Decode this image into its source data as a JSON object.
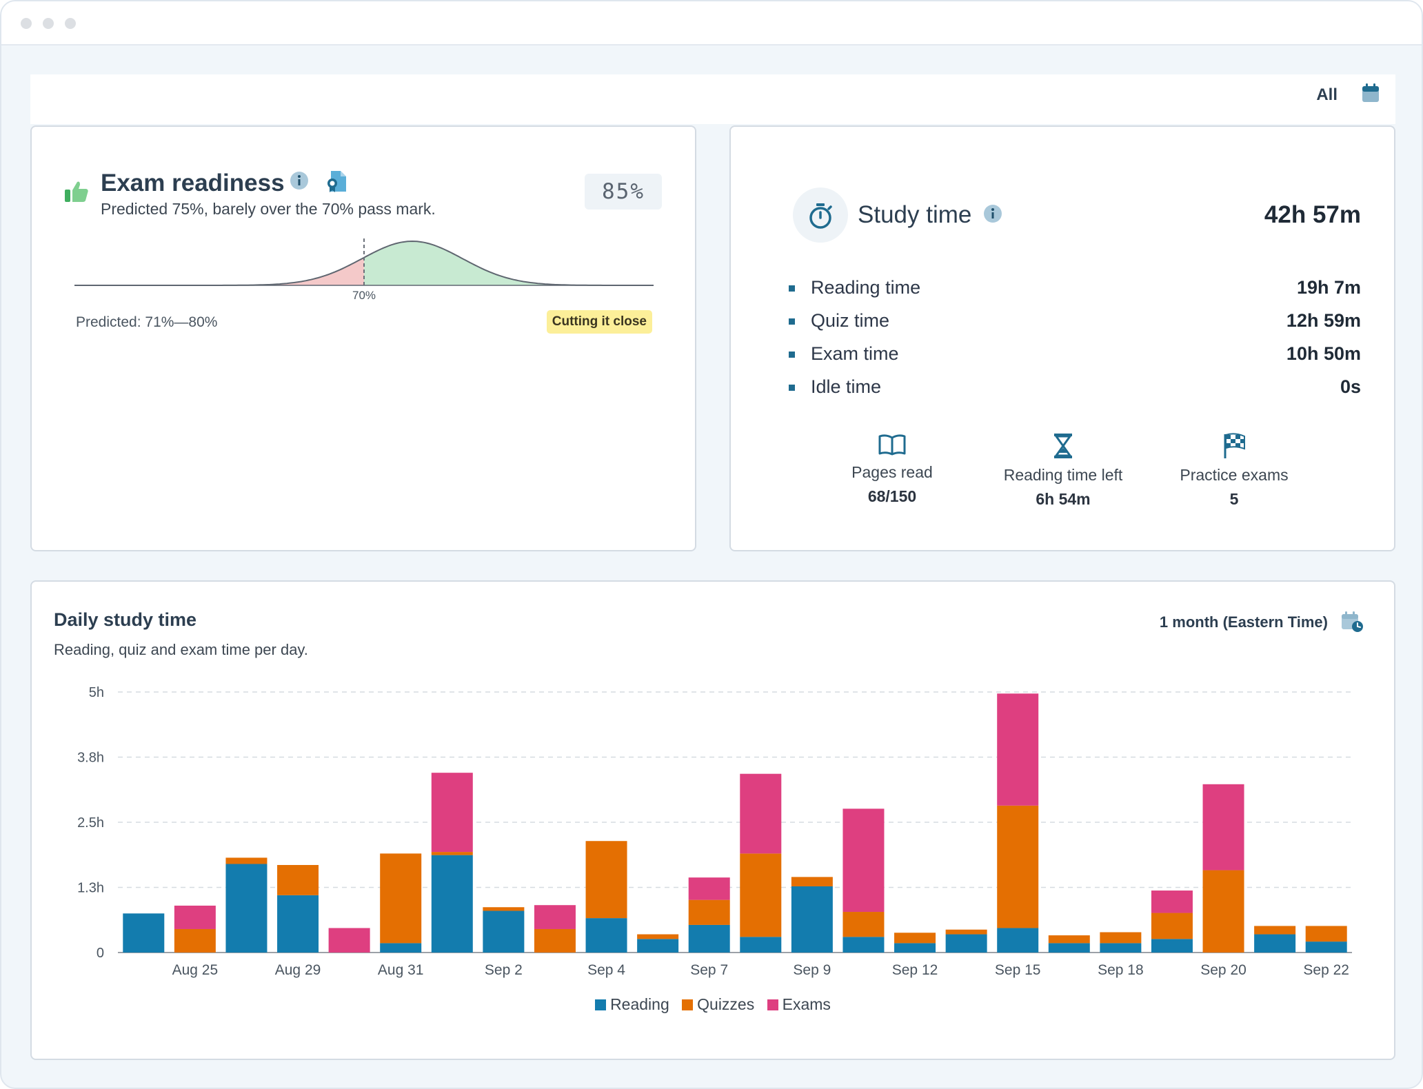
{
  "toolbar": {
    "range_label": "All"
  },
  "exam_readiness": {
    "title": "Exam readiness",
    "subtitle": "Predicted 75%, barely over the 70% pass mark.",
    "percent": "85%",
    "pass_mark_label": "70%",
    "pass_mark": 70,
    "prediction_mean": 75,
    "predicted_range": "Predicted: 71%—80%",
    "badge": "Cutting it close",
    "colors": {
      "below": "#f4c9c9",
      "above": "#c8ead2",
      "curve": "#5f6670"
    }
  },
  "study_time": {
    "title": "Study time",
    "total": "42h 57m",
    "rows": [
      {
        "label": "Reading time",
        "value": "19h 7m"
      },
      {
        "label": "Quiz time",
        "value": "12h 59m"
      },
      {
        "label": "Exam time",
        "value": "10h 50m"
      },
      {
        "label": "Idle time",
        "value": "0s"
      }
    ],
    "stats": [
      {
        "icon": "book-icon",
        "label": "Pages read",
        "value": "68/150"
      },
      {
        "icon": "hourglass-icon",
        "label": "Reading time left",
        "value": "6h 54m"
      },
      {
        "icon": "checkered-flag-icon",
        "label": "Practice exams",
        "value": "5"
      }
    ]
  },
  "daily": {
    "title": "Daily study time",
    "subtitle": "Reading, quiz and exam time per day.",
    "range": "1 month (Eastern Time)"
  },
  "chart_data": {
    "type": "bar",
    "stacked": true,
    "title": "Daily study time",
    "ylim": [
      0,
      5
    ],
    "y_ticks": [
      {
        "value": 0,
        "label": "0"
      },
      {
        "value": 1.25,
        "label": "1.3h"
      },
      {
        "value": 2.5,
        "label": "2.5h"
      },
      {
        "value": 3.75,
        "label": "3.8h"
      },
      {
        "value": 5,
        "label": "5h"
      }
    ],
    "x_tick_labels": [
      "Aug 25",
      "Aug 29",
      "Aug 31",
      "Sep 2",
      "Sep 4",
      "Sep 7",
      "Sep 9",
      "Sep 12",
      "Sep 15",
      "Sep 18",
      "Sep 20",
      "Sep 22"
    ],
    "grid": "horizontal dashed",
    "legend_position": "bottom-center",
    "series": [
      {
        "name": "Reading",
        "color": "#137cae",
        "values": [
          0.75,
          0,
          1.7,
          1.1,
          0,
          0.18,
          1.87,
          0.8,
          0,
          0.66,
          0.26,
          0.53,
          0.3,
          1.27,
          0.3,
          0.18,
          0.35,
          0.47,
          0.18,
          0.18,
          0.26,
          0,
          0.35,
          0.21
        ]
      },
      {
        "name": "Quizzes",
        "color": "#e46f02",
        "values": [
          0,
          0.45,
          0.12,
          0.58,
          0,
          1.72,
          0.06,
          0.07,
          0.45,
          1.48,
          0.09,
          0.48,
          1.6,
          0.18,
          0.48,
          0.2,
          0.09,
          2.35,
          0.15,
          0.21,
          0.5,
          1.58,
          0.16,
          0.3
        ]
      },
      {
        "name": "Exams",
        "color": "#de3f80",
        "values": [
          0,
          0.45,
          0,
          0,
          0.47,
          0,
          1.52,
          0,
          0.46,
          0,
          0,
          0.43,
          1.53,
          0,
          1.98,
          0,
          0,
          2.15,
          0,
          0,
          0.43,
          1.65,
          0,
          0
        ]
      }
    ]
  }
}
